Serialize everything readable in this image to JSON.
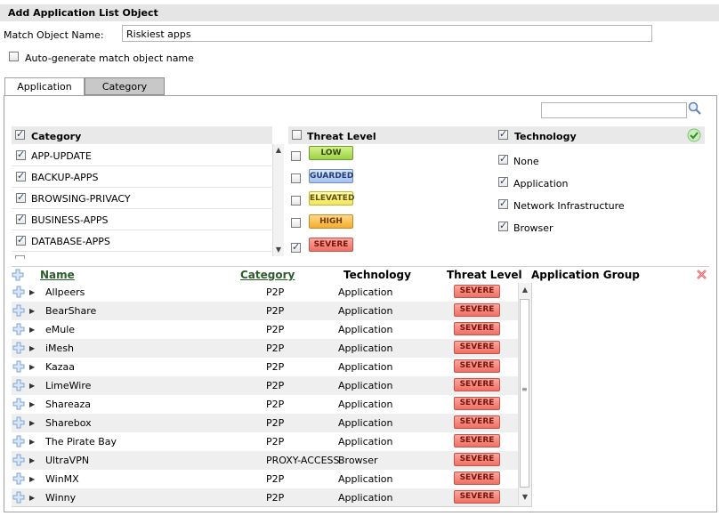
{
  "dialog": {
    "title": "Add Application List Object"
  },
  "form": {
    "match_label": "Match Object Name:",
    "match_value": "Riskiest apps",
    "autogen_label": "Auto-generate match object name"
  },
  "tabs": [
    {
      "label": "Application"
    },
    {
      "label": "Category"
    }
  ],
  "filters": {
    "category_header": "Category",
    "categories": [
      "APP-UPDATE",
      "BACKUP-APPS",
      "BROWSING-PRIVACY",
      "BUSINESS-APPS",
      "DATABASE-APPS"
    ],
    "threat_header": "Threat Level",
    "threat_levels": [
      "LOW",
      "GUARDED",
      "ELEVATED",
      "HIGH",
      "SEVERE"
    ],
    "technology_header": "Technology",
    "technologies": [
      "None",
      "Application",
      "Network Infrastructure",
      "Browser"
    ]
  },
  "table": {
    "headers": {
      "name": "Name",
      "category": "Category",
      "technology": "Technology",
      "threat": "Threat Level",
      "group": "Application Group"
    },
    "rows": [
      {
        "name": "Allpeers",
        "category": "P2P",
        "technology": "Application",
        "threat": "SEVERE"
      },
      {
        "name": "BearShare",
        "category": "P2P",
        "technology": "Application",
        "threat": "SEVERE"
      },
      {
        "name": "eMule",
        "category": "P2P",
        "technology": "Application",
        "threat": "SEVERE"
      },
      {
        "name": "iMesh",
        "category": "P2P",
        "technology": "Application",
        "threat": "SEVERE"
      },
      {
        "name": "Kazaa",
        "category": "P2P",
        "technology": "Application",
        "threat": "SEVERE"
      },
      {
        "name": "LimeWire",
        "category": "P2P",
        "technology": "Application",
        "threat": "SEVERE"
      },
      {
        "name": "Shareaza",
        "category": "P2P",
        "technology": "Application",
        "threat": "SEVERE"
      },
      {
        "name": "Sharebox",
        "category": "P2P",
        "technology": "Application",
        "threat": "SEVERE"
      },
      {
        "name": "The Pirate Bay",
        "category": "P2P",
        "technology": "Application",
        "threat": "SEVERE"
      },
      {
        "name": "UltraVPN",
        "category": "PROXY-ACCESS",
        "technology": "Browser",
        "threat": "SEVERE"
      },
      {
        "name": "WinMX",
        "category": "P2P",
        "technology": "Application",
        "threat": "SEVERE"
      },
      {
        "name": "Winny",
        "category": "P2P",
        "technology": "Application",
        "threat": "SEVERE"
      }
    ]
  },
  "colors": {
    "severe": "#ee7064",
    "header_bg": "#e5e5e5",
    "link": "#2b5d2b"
  }
}
